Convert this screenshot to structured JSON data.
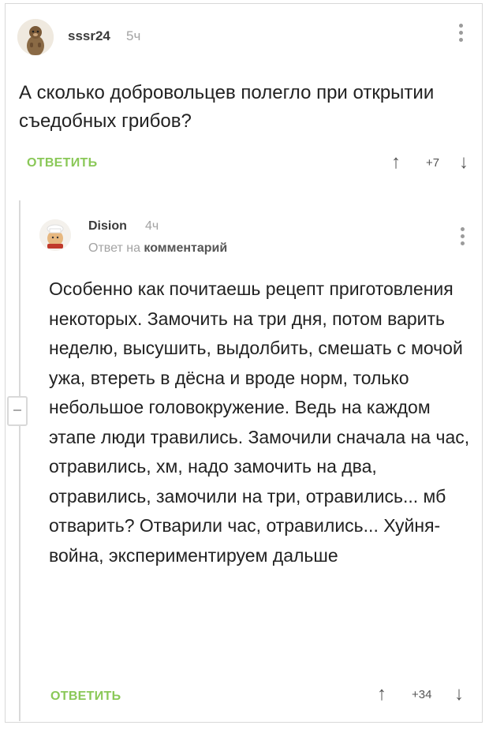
{
  "comment": {
    "username": "sssr24",
    "time": "5ч",
    "text": "А сколько добровольцев полегло при открытии съедобных грибов?",
    "reply_label": "ОТВЕТИТЬ",
    "score": "+7"
  },
  "reply": {
    "username": "Dision",
    "time": "4ч",
    "reply_to_prefix": "Ответ на",
    "reply_to_target": "комментарий",
    "text": "Особенно как почитаешь рецепт приготовления некоторых. Замочить на три дня, потом варить неделю, высушить, выдолбить, смешать с мочой ужа, втереть в дёсна и вроде норм, только небольшое головокружение. Ведь на каждом этапе люди травились. Замочили сначала на час, отравились, хм, надо замочить на два, отравились, замочили на три, отравились... мб отварить? Отварили час, отравились... Хуйня-война, экспериментируем дальше",
    "reply_label": "ОТВЕТИТЬ",
    "score": "+34"
  },
  "icons": {
    "upvote": "↑",
    "downvote": "↓"
  },
  "colors": {
    "accent_green": "#8ac858",
    "muted_text": "#a3a3a3"
  }
}
